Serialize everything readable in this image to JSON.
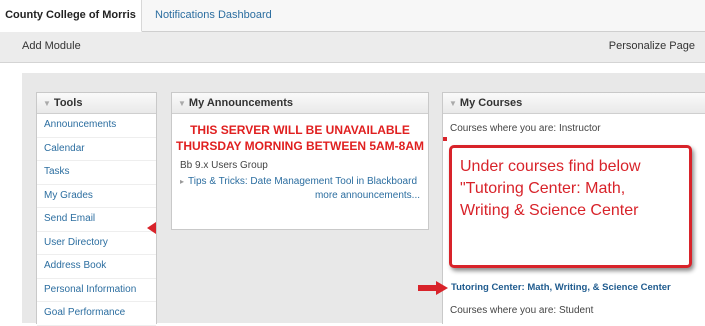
{
  "tabs": {
    "active": "County College of Morris",
    "notifications": "Notifications Dashboard"
  },
  "toolbar": {
    "add_module": "Add Module",
    "personalize": "Personalize Page"
  },
  "tools": {
    "title": "Tools",
    "items": [
      "Announcements",
      "Calendar",
      "Tasks",
      "My Grades",
      "Send Email",
      "User Directory",
      "Address Book",
      "Personal Information",
      "Goal Performance"
    ]
  },
  "announcements": {
    "title": "My Announcements",
    "warning_line1": "THIS SERVER WILL BE UNAVAILABLE",
    "warning_line2": "THURSDAY MORNING BETWEEN 5AM-8AM",
    "group": "Bb 9.x Users Group",
    "tip": "Tips & Tricks: Date Management Tool in Blackboard",
    "more": "more announcements..."
  },
  "courses": {
    "title": "My Courses",
    "role_instructor": "Courses where you are: Instructor",
    "course_link": "Tutoring Center: Math, Writing, & Science Center",
    "role_student": "Courses where you are: Student"
  },
  "callout": {
    "text": "Under courses find below \"Tutoring Center: Math, Writing & Science Center"
  },
  "colors": {
    "accent_red": "#d8232a",
    "link_blue": "#2c6ea0"
  },
  "icons": {
    "module_collapse": "triangle-down-icon",
    "tip_expand": "caret-right-icon",
    "pointer_arrow": "red-arrow-icon"
  }
}
